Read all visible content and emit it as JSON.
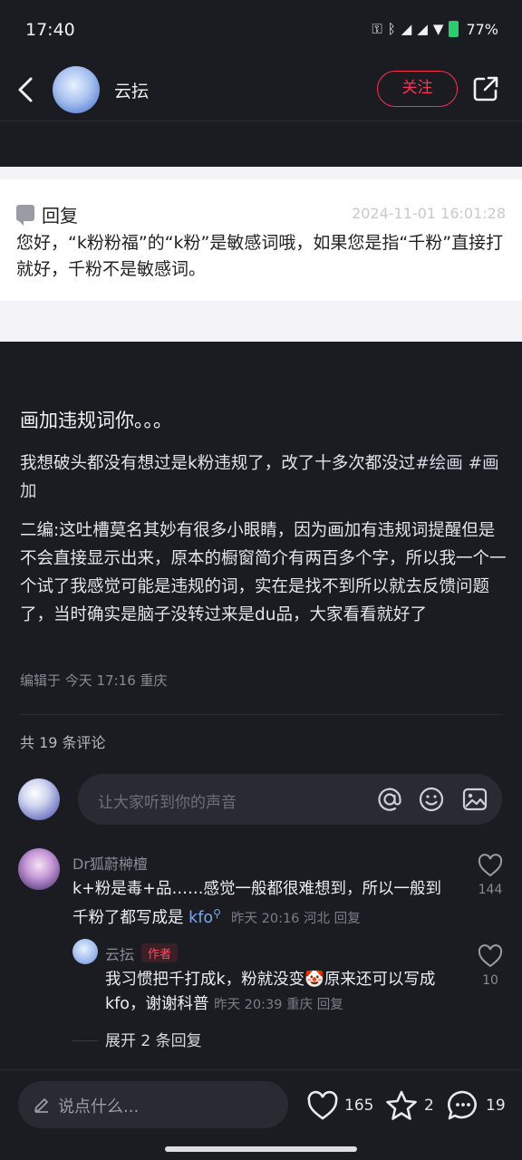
{
  "status_bar": {
    "time": "17:40",
    "battery": "77%"
  },
  "header": {
    "username": "云抎",
    "follow_label": "关注"
  },
  "reply_card": {
    "title": "回复",
    "date": "2024-11-01 16:01:28",
    "body": "您好，“k粉粉福”的“k粉”是敏感词哦，如果您是指“千粉”直接打就好，千粉不是敏感词。"
  },
  "post": {
    "title": "画加违规词你。。。",
    "para1_text": "我想破头都没有想过是k粉违规了，改了十多次都没过",
    "para1_tags": "#绘画 #画加",
    "para2": "二编:这吐槽莫名其妙有很多小眼睛，因为画加有违规词提醒但是不会直接显示出来，原本的橱窗简介有两百多个字，所以我一个一个试了我感觉可能是违规的词，实在是找不到所以就去反馈问题了，当时确实是脑子没转过来是du品，大家看看就好了",
    "meta": "编辑于 今天 17:16 重庆"
  },
  "comments_count": "共 19 条评论",
  "composer": {
    "placeholder": "让大家听到你的声音"
  },
  "comments": [
    {
      "name": "Dr狐蔚榊檀",
      "text": "k+粉是毒+品……感觉一般都很难想到，所以一般到千粉了都写成是 ",
      "link": "kfo",
      "meta": "昨天 20:16 河北 回复",
      "likes": "144"
    },
    {
      "name": "云抎",
      "badge": "作者",
      "text": "我习惯把千打成k，粉就没变🤡原来还可以写成kfo，谢谢科普 ",
      "meta": "昨天 20:39 重庆 回复",
      "likes": "10"
    }
  ],
  "expand_label": "展开 2 条回复",
  "bottom_bar": {
    "input_placeholder": "说点什么...",
    "likes": "165",
    "stars": "2",
    "comments": "19"
  },
  "colors": {
    "accent": "#ff2e4d",
    "background": "#1b1b22",
    "link": "#7da7e6"
  }
}
